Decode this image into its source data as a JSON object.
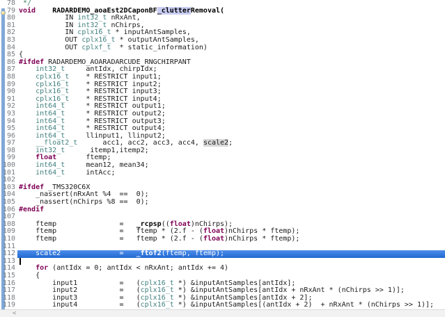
{
  "editor": {
    "colors": {
      "keyword": "#7f0055",
      "type": "#3f7f7e",
      "comment": "#3f7f5f",
      "linenum": "#787b80",
      "sel_top": "#4f8ee9",
      "sel_bottom": "#1f67d2",
      "occ_word": "#c9cdf2",
      "occ_write": "#d8d8d8",
      "range_bar": "#7fa8d7",
      "caret": "#000000",
      "scroll_bg": "#f2f2f2",
      "scroll_arrow": "#909090"
    },
    "selected_line": 112,
    "caret_line": 113,
    "scrollbar": {
      "left_arrow_glyph": "<"
    },
    "lines": [
      {
        "n": 78,
        "tokens": [
          [
            "com",
            " */"
          ]
        ]
      },
      {
        "n": 79,
        "tokens": [
          [
            "k",
            "void"
          ],
          [
            "p",
            "    "
          ],
          [
            "fn",
            "RADARDEMO_aoaEst2DCaponBF"
          ],
          [
            "fn occ1",
            "_clutter"
          ],
          [
            "fn",
            "Removal("
          ]
        ]
      },
      {
        "n": 80,
        "tokens": [
          [
            "p",
            "           IN "
          ],
          [
            "t",
            "int32_t"
          ],
          [
            "p",
            " nRxAnt,"
          ]
        ]
      },
      {
        "n": 81,
        "tokens": [
          [
            "p",
            "           IN "
          ],
          [
            "t",
            "int32_t"
          ],
          [
            "p",
            " nChirps,"
          ]
        ]
      },
      {
        "n": 82,
        "tokens": [
          [
            "p",
            "           IN "
          ],
          [
            "t",
            "cplx16_t"
          ],
          [
            "p",
            " * inputAntSamples,"
          ]
        ]
      },
      {
        "n": 83,
        "tokens": [
          [
            "p",
            "           OUT "
          ],
          [
            "t",
            "cplx16_t"
          ],
          [
            "p",
            " * outputAntSamples,"
          ]
        ]
      },
      {
        "n": 84,
        "tokens": [
          [
            "p",
            "           OUT "
          ],
          [
            "t",
            "cplxf_t"
          ],
          [
            "p",
            "  * static_information)"
          ]
        ]
      },
      {
        "n": 85,
        "tokens": [
          [
            "p",
            "{"
          ]
        ]
      },
      {
        "n": 86,
        "tokens": [
          [
            "k",
            "#ifdef"
          ],
          [
            "p",
            " RADARDEMO_AOARADARCUDE_RNGCHIRPANT"
          ]
        ]
      },
      {
        "n": 87,
        "tokens": [
          [
            "p",
            "    "
          ],
          [
            "t",
            "int32_t"
          ],
          [
            "p",
            "     antIdx, chirpIdx;"
          ]
        ]
      },
      {
        "n": 88,
        "tokens": [
          [
            "p",
            "    "
          ],
          [
            "t",
            "cplx16_t"
          ],
          [
            "p",
            "    * RESTRICT input1;"
          ]
        ]
      },
      {
        "n": 89,
        "tokens": [
          [
            "p",
            "    "
          ],
          [
            "t",
            "cplx16_t"
          ],
          [
            "p",
            "    * RESTRICT input2;"
          ]
        ]
      },
      {
        "n": 90,
        "tokens": [
          [
            "p",
            "    "
          ],
          [
            "t",
            "cplx16_t"
          ],
          [
            "p",
            "    * RESTRICT input3;"
          ]
        ]
      },
      {
        "n": 91,
        "tokens": [
          [
            "p",
            "    "
          ],
          [
            "t",
            "cplx16_t"
          ],
          [
            "p",
            "    * RESTRICT input4;"
          ]
        ]
      },
      {
        "n": 92,
        "tokens": [
          [
            "p",
            "    "
          ],
          [
            "t",
            "int64_t"
          ],
          [
            "p",
            "     * RESTRICT output1;"
          ]
        ]
      },
      {
        "n": 93,
        "tokens": [
          [
            "p",
            "    "
          ],
          [
            "t",
            "int64_t"
          ],
          [
            "p",
            "     * RESTRICT output2;"
          ]
        ]
      },
      {
        "n": 94,
        "tokens": [
          [
            "p",
            "    "
          ],
          [
            "t",
            "int64_t"
          ],
          [
            "p",
            "     * RESTRICT output3;"
          ]
        ]
      },
      {
        "n": 95,
        "tokens": [
          [
            "p",
            "    "
          ],
          [
            "t",
            "int64_t"
          ],
          [
            "p",
            "     * RESTRICT output4;"
          ]
        ]
      },
      {
        "n": 96,
        "tokens": [
          [
            "p",
            "    "
          ],
          [
            "t",
            "int64_t"
          ],
          [
            "p",
            "     llinput1, llinput2;"
          ]
        ]
      },
      {
        "n": 97,
        "tokens": [
          [
            "p",
            "    "
          ],
          [
            "t",
            "__float2_t"
          ],
          [
            "p",
            "      acc1, acc2, acc3, acc4, "
          ],
          [
            "p occ2",
            "scale2"
          ],
          [
            "p",
            ";"
          ]
        ]
      },
      {
        "n": 98,
        "tokens": [
          [
            "p",
            "    "
          ],
          [
            "t",
            "int32_t"
          ],
          [
            "p",
            "      itemp1,itemp2;"
          ]
        ]
      },
      {
        "n": 99,
        "tokens": [
          [
            "p",
            "    "
          ],
          [
            "k",
            "float"
          ],
          [
            "p",
            "       ftemp;"
          ]
        ]
      },
      {
        "n": 100,
        "tokens": [
          [
            "p",
            "    "
          ],
          [
            "t",
            "int64_t"
          ],
          [
            "p",
            "     mean12, mean34;"
          ]
        ]
      },
      {
        "n": 101,
        "tokens": [
          [
            "p",
            "    "
          ],
          [
            "t",
            "int64_t"
          ],
          [
            "p",
            "     intAcc;"
          ]
        ]
      },
      {
        "n": 102,
        "tokens": []
      },
      {
        "n": 103,
        "tokens": [
          [
            "k",
            "#ifdef"
          ],
          [
            "p",
            " _TMS320C6X"
          ]
        ]
      },
      {
        "n": 104,
        "tokens": [
          [
            "p",
            "    _nassert(nRxAnt %4  ==  0);"
          ]
        ]
      },
      {
        "n": 105,
        "tokens": [
          [
            "p",
            "    _nassert(nChirps %8 ==  0);"
          ]
        ]
      },
      {
        "n": 106,
        "tokens": [
          [
            "k",
            "#endif"
          ]
        ]
      },
      {
        "n": 107,
        "tokens": []
      },
      {
        "n": 108,
        "tokens": [
          [
            "p",
            "    ftemp               =   "
          ],
          [
            "fn",
            "_rcpsp"
          ],
          [
            "p",
            "(("
          ],
          [
            "k",
            "float"
          ],
          [
            "p",
            ")nChirps);"
          ]
        ]
      },
      {
        "n": 109,
        "tokens": [
          [
            "p",
            "    ftemp               =   ftemp * (2.f - ("
          ],
          [
            "k",
            "float"
          ],
          [
            "p",
            ")nChirps * ftemp);"
          ]
        ]
      },
      {
        "n": 110,
        "tokens": [
          [
            "p",
            "    ftemp               =   ftemp * (2.f - ("
          ],
          [
            "k",
            "float"
          ],
          [
            "p",
            ")nChirps * ftemp);"
          ]
        ]
      },
      {
        "n": 111,
        "tokens": []
      },
      {
        "n": 112,
        "tokens": [
          [
            "p",
            "    scale2              =   "
          ],
          [
            "fn",
            "_ftof2"
          ],
          [
            "p",
            "(ftemp, ftemp);"
          ]
        ]
      },
      {
        "n": 113,
        "tokens": []
      },
      {
        "n": 114,
        "tokens": [
          [
            "p",
            "    "
          ],
          [
            "k",
            "for"
          ],
          [
            "p",
            " (antIdx = 0; antIdx < nRxAnt; antIdx += 4)"
          ]
        ]
      },
      {
        "n": 115,
        "tokens": [
          [
            "p",
            "    {"
          ]
        ]
      },
      {
        "n": 116,
        "tokens": [
          [
            "p",
            "        input1          =   ("
          ],
          [
            "t",
            "cplx16_t"
          ],
          [
            "p",
            " *) &inputAntSamples[antIdx];"
          ]
        ]
      },
      {
        "n": 117,
        "tokens": [
          [
            "p",
            "        input2          =   ("
          ],
          [
            "t",
            "cplx16_t"
          ],
          [
            "p",
            " *) &inputAntSamples[antIdx + nRxAnt * (nChirps >> 1)];"
          ]
        ]
      },
      {
        "n": 118,
        "tokens": [
          [
            "p",
            "        input3          =   ("
          ],
          [
            "t",
            "cplx16_t"
          ],
          [
            "p",
            " *) &inputAntSamples[antIdx + 2];"
          ]
        ]
      },
      {
        "n": 119,
        "tokens": [
          [
            "p",
            "        input4          =   ("
          ],
          [
            "t",
            "cplx16_t"
          ],
          [
            "p",
            " *) &inputAntSamples[(antIdx + 2)  + nRxAnt * (nChirps >> 1)];"
          ]
        ]
      }
    ]
  }
}
